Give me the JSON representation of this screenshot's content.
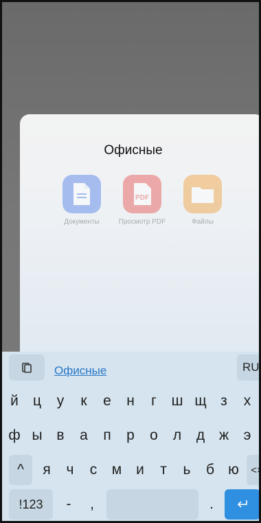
{
  "folder": {
    "title": "Офисные",
    "apps": [
      {
        "label": "Документы",
        "icon": "document-icon",
        "color": "#4d7de8"
      },
      {
        "label": "Просмотр PDF",
        "icon": "pdf-icon",
        "color": "#e85050"
      },
      {
        "label": "Файлы",
        "icon": "folder-icon",
        "color": "#f0a03a"
      }
    ]
  },
  "keyboard": {
    "clipboard_icon": "clipboard-icon",
    "suggestion": "Офисные",
    "language": "RU",
    "row1": [
      "й",
      "ц",
      "у",
      "к",
      "е",
      "н",
      "г",
      "ш",
      "щ",
      "з",
      "х"
    ],
    "row2": [
      "ф",
      "ы",
      "в",
      "а",
      "п",
      "р",
      "о",
      "л",
      "д",
      "ж",
      "э"
    ],
    "row3": [
      "^",
      "я",
      "ч",
      "с",
      "м",
      "и",
      "т",
      "ь",
      "б",
      "ю",
      "<×"
    ],
    "bottom": {
      "symbols": "!123",
      "dash": "-",
      "comma": ",",
      "period": ".",
      "enter_icon": "enter-icon"
    },
    "colors": {
      "accent": "#2f8fe0",
      "background": "#d5e4ee"
    }
  }
}
